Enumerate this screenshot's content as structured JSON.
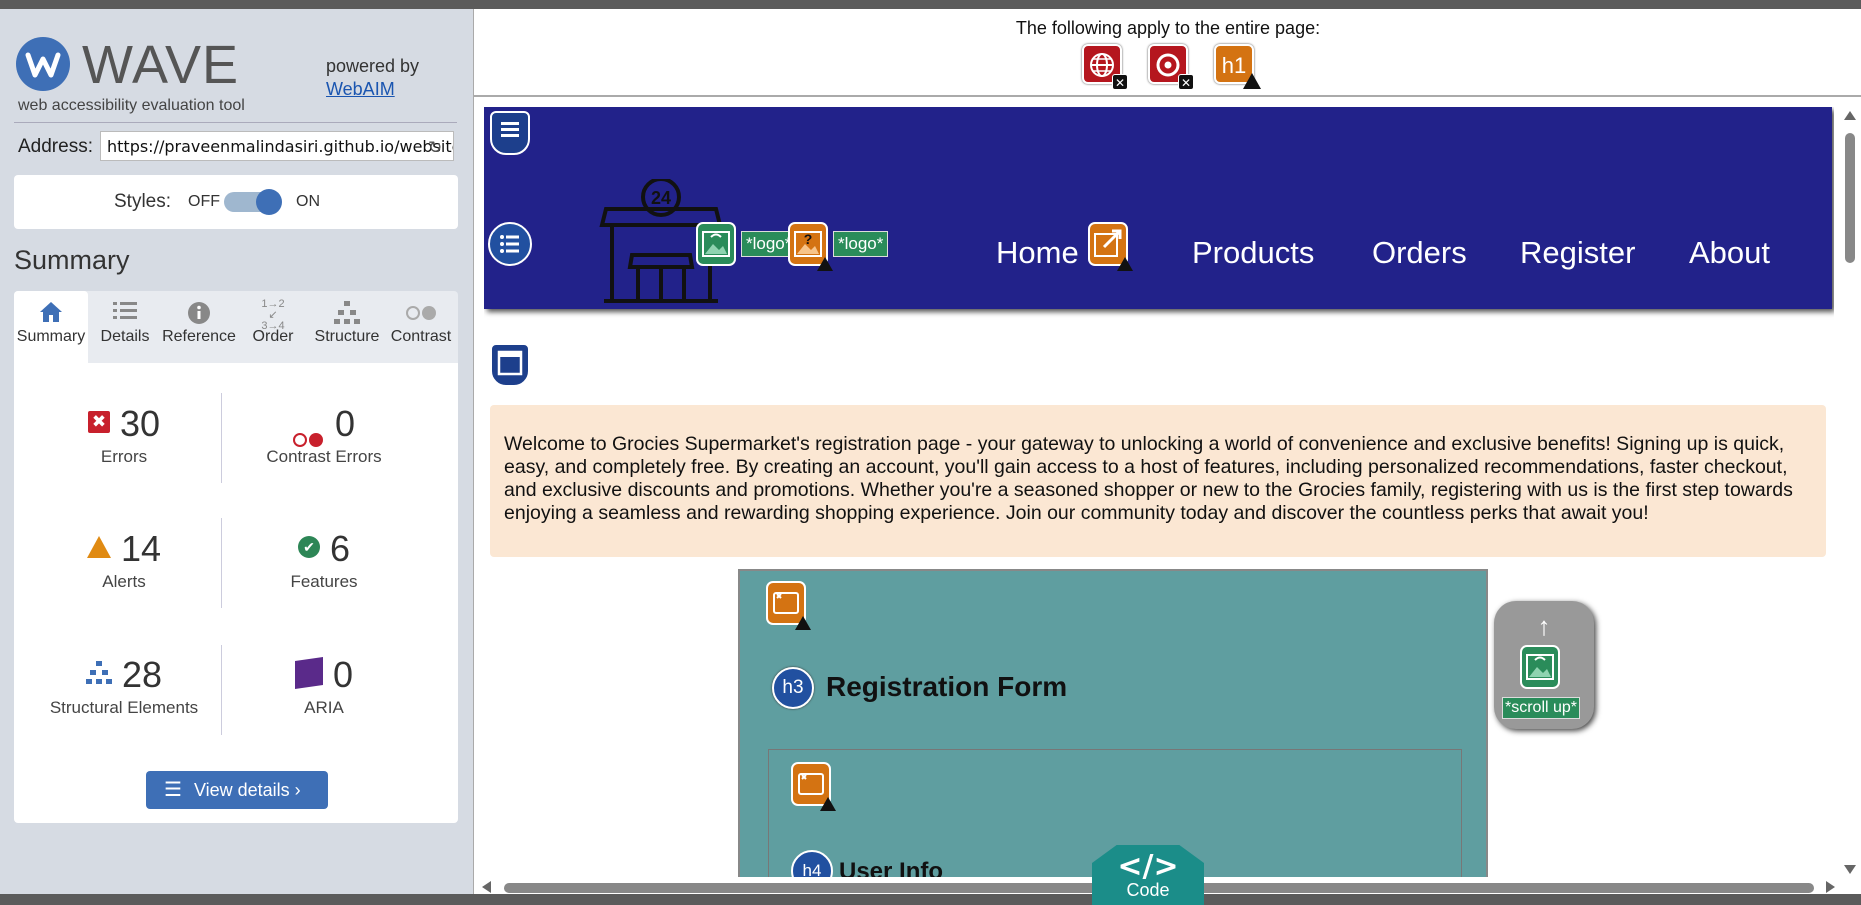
{
  "wave": {
    "title": "WAVE",
    "subtitle": "web accessibility evaluation tool",
    "powered_by": "powered by",
    "webaim_link": "WebAIM",
    "address_label": "Address:",
    "address_value": "https://praveenmalindasiri.github.io/website",
    "styles_label": "Styles:",
    "styles_off": "OFF",
    "styles_on": "ON",
    "summary_title": "Summary",
    "tabs": [
      {
        "label": "Summary",
        "icon": "home-icon"
      },
      {
        "label": "Details",
        "icon": "list-icon"
      },
      {
        "label": "Reference",
        "icon": "info-icon"
      },
      {
        "label": "Order",
        "icon": "order-icon"
      },
      {
        "label": "Structure",
        "icon": "structure-icon"
      },
      {
        "label": "Contrast",
        "icon": "contrast-icon"
      }
    ],
    "stats": {
      "errors": {
        "count": "30",
        "label": "Errors"
      },
      "contrast_errors": {
        "count": "0",
        "label": "Contrast Errors"
      },
      "alerts": {
        "count": "14",
        "label": "Alerts"
      },
      "features": {
        "count": "6",
        "label": "Features"
      },
      "structural": {
        "count": "28",
        "label": "Structural Elements"
      },
      "aria": {
        "count": "0",
        "label": "ARIA"
      }
    },
    "view_details": "View details ›"
  },
  "page_header": {
    "text": "The following apply to the entire page:",
    "icons": [
      {
        "name": "language-missing-icon",
        "glyph": "🌐",
        "color": "#b5161e"
      },
      {
        "name": "autoplay-icon",
        "glyph": "◉",
        "color": "#b5161e"
      },
      {
        "name": "h1-missing-icon",
        "glyph": "h1",
        "color": "#d47312"
      }
    ]
  },
  "site": {
    "nav": {
      "logo_label_1": "*logo*",
      "logo_label_2": "*logo*",
      "store_number": "24",
      "links": [
        "Home",
        "Products",
        "Orders",
        "Register",
        "About"
      ]
    },
    "intro_text": "Welcome to Grocies Supermarket's registration page - your gateway to unlocking a world of convenience and exclusive benefits! Signing up is quick, easy, and completely free. By creating an account, you'll gain access to a host of features, including personalized recommendations, faster checkout, and exclusive discounts and promotions. Whether you're a seasoned shopper or new to the Grocies family, registering with us is the first step towards enjoying a seamless and rewarding shopping experience. Join our community today and discover the countless perks that await you!",
    "form_title": "Registration Form",
    "h3": "h3",
    "h4": "h4",
    "user_info": "User Info",
    "scroll_up_label": "*scroll up*",
    "code_label": "Code",
    "code_symbol": "</>"
  },
  "colors": {
    "wave_blue": "#3e6fb6",
    "error_red": "#c8202c",
    "alert_orange": "#e08a12",
    "feature_green": "#2d8656",
    "nav_bg": "#22228a",
    "intro_bg": "#fbe7d3",
    "form_bg": "#5f9ea0",
    "code_teal": "#1b8d89"
  }
}
